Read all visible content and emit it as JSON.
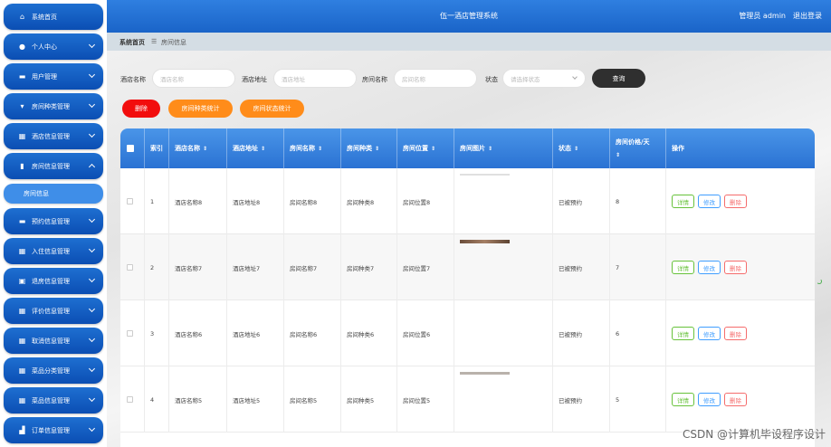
{
  "app": {
    "title": "伍一酒店管理系统",
    "user_label": "管理员 admin",
    "logout_label": "退出登录"
  },
  "breadcrumb": {
    "home": "系统首页",
    "separator": "☰",
    "current": "房间信息"
  },
  "sidebar": {
    "items": [
      {
        "label": "系统首页",
        "icon": "home-icon"
      },
      {
        "label": "个人中心",
        "icon": "user-icon"
      },
      {
        "label": "用户管理",
        "icon": "users-icon"
      },
      {
        "label": "房间种类管理",
        "icon": "category-icon"
      },
      {
        "label": "酒店信息管理",
        "icon": "grid-icon"
      },
      {
        "label": "房间信息管理",
        "icon": "chart-icon"
      },
      {
        "label": "预约信息管理",
        "icon": "book-icon"
      },
      {
        "label": "入住信息管理",
        "icon": "grid-icon"
      },
      {
        "label": "退房信息管理",
        "icon": "checkout-icon"
      },
      {
        "label": "评价信息管理",
        "icon": "grid-icon"
      },
      {
        "label": "取消信息管理",
        "icon": "grid-icon"
      },
      {
        "label": "菜品分类管理",
        "icon": "grid-icon"
      },
      {
        "label": "菜品信息管理",
        "icon": "grid-icon"
      },
      {
        "label": "订单信息管理",
        "icon": "order-icon"
      }
    ],
    "sub_item": "房间信息"
  },
  "search": {
    "hotel_name": {
      "label": "酒店名称",
      "placeholder": "酒店名称"
    },
    "hotel_address": {
      "label": "酒店地址",
      "placeholder": "酒店地址"
    },
    "room_name": {
      "label": "房间名称",
      "placeholder": "房间名称"
    },
    "status": {
      "label": "状态",
      "placeholder": "请选择状态"
    },
    "query_label": "查询"
  },
  "actions": {
    "delete": "删除",
    "type_stats": "房间种类统计",
    "status_stats": "房间状态统计"
  },
  "table": {
    "headers": [
      "索引",
      "酒店名称",
      "酒店地址",
      "房间名称",
      "房间种类",
      "房间位置",
      "房间图片",
      "状态",
      "房间价格/天",
      "操作"
    ],
    "sort_icon": "⇕",
    "ops": {
      "detail": "详情",
      "edit": "修改",
      "remove": "删除"
    },
    "rows": [
      {
        "index": "1",
        "hotel_name": "酒店名称8",
        "hotel_address": "酒店地址8",
        "room_name": "房间名称8",
        "room_type": "房间种类8",
        "location": "房间位置8",
        "status": "已被预约",
        "price": "8"
      },
      {
        "index": "2",
        "hotel_name": "酒店名称7",
        "hotel_address": "酒店地址7",
        "room_name": "房间名称7",
        "room_type": "房间种类7",
        "location": "房间位置7",
        "status": "已被预约",
        "price": "7"
      },
      {
        "index": "3",
        "hotel_name": "酒店名称6",
        "hotel_address": "酒店地址6",
        "room_name": "房间名称6",
        "room_type": "房间种类6",
        "location": "房间位置6",
        "status": "已被预约",
        "price": "6"
      },
      {
        "index": "4",
        "hotel_name": "酒店名称5",
        "hotel_address": "酒店地址5",
        "room_name": "房间名称5",
        "room_type": "房间种类5",
        "location": "房间位置5",
        "status": "已被预约",
        "price": "5"
      }
    ]
  },
  "watermark": "CSDN @计算机毕设程序设计"
}
